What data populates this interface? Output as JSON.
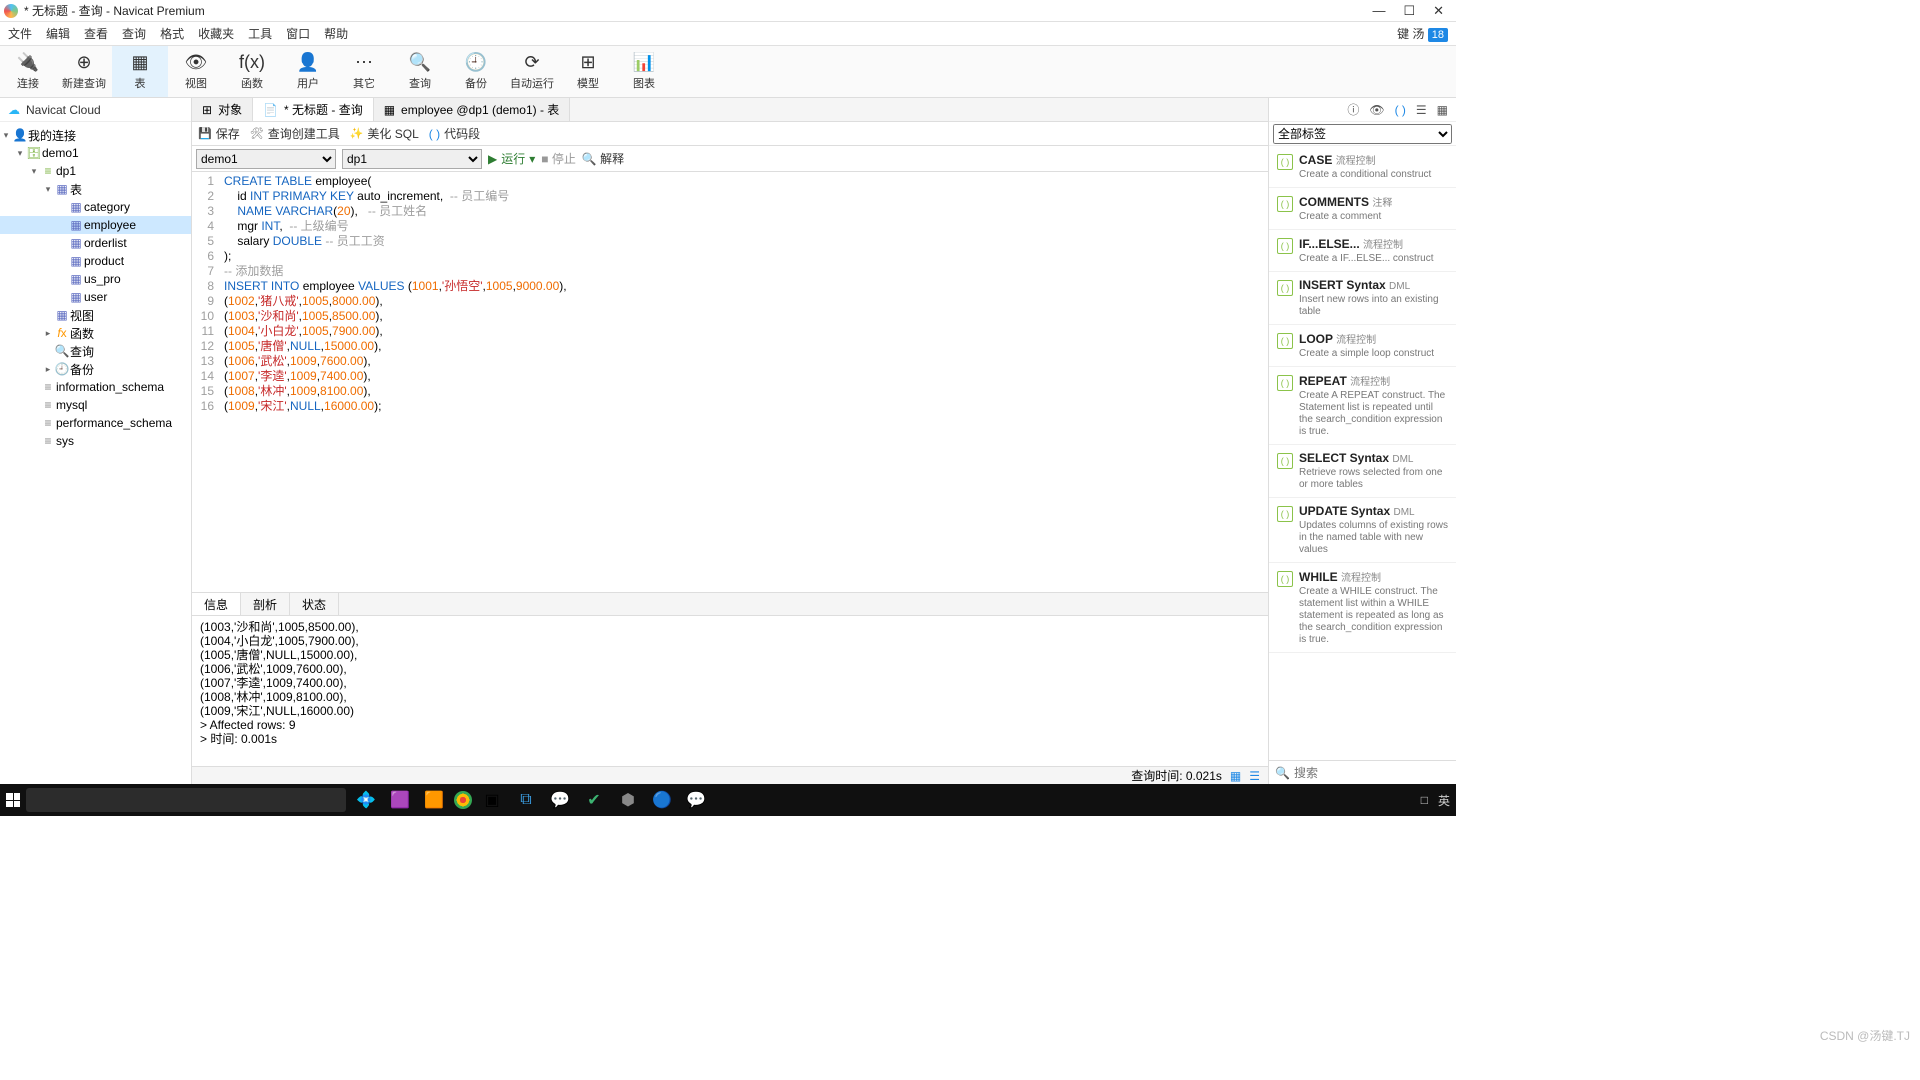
{
  "window": {
    "title": "* 无标题 - 查询 - Navicat Premium"
  },
  "menu": {
    "items": [
      "文件",
      "编辑",
      "查看",
      "查询",
      "格式",
      "收藏夹",
      "工具",
      "窗口",
      "帮助"
    ],
    "user": "键 汤",
    "badge": "18"
  },
  "toolbar": [
    {
      "icon": "🔌",
      "label": "连接"
    },
    {
      "icon": "⊕",
      "label": "新建查询"
    },
    {
      "icon": "▦",
      "label": "表",
      "active": true
    },
    {
      "icon": "👁",
      "label": "视图"
    },
    {
      "icon": "f(x)",
      "label": "函数"
    },
    {
      "icon": "👤",
      "label": "用户"
    },
    {
      "icon": "⋯",
      "label": "其它"
    },
    {
      "icon": "🔍",
      "label": "查询"
    },
    {
      "icon": "🕘",
      "label": "备份"
    },
    {
      "icon": "⟳",
      "label": "自动运行"
    },
    {
      "icon": "⊞",
      "label": "模型"
    },
    {
      "icon": "📊",
      "label": "图表"
    }
  ],
  "cloud": "Navicat Cloud",
  "tree": [
    {
      "d": 0,
      "arr": "▾",
      "ic": "👤",
      "cls": "",
      "txt": "我的连接"
    },
    {
      "d": 1,
      "arr": "▾",
      "ic": "🗄",
      "cls": "db",
      "txt": "demo1"
    },
    {
      "d": 2,
      "arr": "▾",
      "ic": "≡",
      "cls": "db",
      "txt": "dp1"
    },
    {
      "d": 3,
      "arr": "▾",
      "ic": "▦",
      "cls": "tb",
      "txt": "表"
    },
    {
      "d": 4,
      "arr": "",
      "ic": "▦",
      "cls": "tb",
      "txt": "category"
    },
    {
      "d": 4,
      "arr": "",
      "ic": "▦",
      "cls": "tb",
      "txt": "employee",
      "sel": true
    },
    {
      "d": 4,
      "arr": "",
      "ic": "▦",
      "cls": "tb",
      "txt": "orderlist"
    },
    {
      "d": 4,
      "arr": "",
      "ic": "▦",
      "cls": "tb",
      "txt": "product"
    },
    {
      "d": 4,
      "arr": "",
      "ic": "▦",
      "cls": "tb",
      "txt": "us_pro"
    },
    {
      "d": 4,
      "arr": "",
      "ic": "▦",
      "cls": "tb",
      "txt": "user"
    },
    {
      "d": 3,
      "arr": "",
      "ic": "▦",
      "cls": "tb",
      "txt": "视图"
    },
    {
      "d": 3,
      "arr": "▸",
      "ic": "fx",
      "cls": "fd",
      "txt": "函数"
    },
    {
      "d": 3,
      "arr": "",
      "ic": "🔍",
      "cls": "tb",
      "txt": "查询"
    },
    {
      "d": 3,
      "arr": "▸",
      "ic": "🕘",
      "cls": "tb",
      "txt": "备份"
    },
    {
      "d": 2,
      "arr": "",
      "ic": "≡",
      "cls": "gy",
      "txt": "information_schema"
    },
    {
      "d": 2,
      "arr": "",
      "ic": "≡",
      "cls": "gy",
      "txt": "mysql"
    },
    {
      "d": 2,
      "arr": "",
      "ic": "≡",
      "cls": "gy",
      "txt": "performance_schema"
    },
    {
      "d": 2,
      "arr": "",
      "ic": "≡",
      "cls": "gy",
      "txt": "sys"
    }
  ],
  "tabs": [
    {
      "icon": "⊞",
      "label": "对象"
    },
    {
      "icon": "📄",
      "label": "* 无标题 - 查询",
      "active": true
    },
    {
      "icon": "▦",
      "label": "employee @dp1 (demo1) - 表"
    }
  ],
  "querybar": {
    "save": "保存",
    "tools": "查询创建工具",
    "beautify": "美化 SQL",
    "snippet": "代码段"
  },
  "selrow": {
    "conn": "demo1",
    "db": "dp1",
    "run": "运行",
    "stop": "停止",
    "explain": "解释"
  },
  "code": [
    [
      [
        "kw",
        "CREATE TABLE"
      ],
      [
        "",
        " employee("
      ]
    ],
    [
      [
        "",
        "    id "
      ],
      [
        "ty",
        "INT PRIMARY KEY"
      ],
      [
        "",
        " auto_increment,  "
      ],
      [
        "cm",
        "-- 员工编号"
      ]
    ],
    [
      [
        "",
        "    "
      ],
      [
        "ty",
        "NAME VARCHAR"
      ],
      [
        "",
        "("
      ],
      [
        "num",
        "20"
      ],
      [
        "",
        "),   "
      ],
      [
        "cm",
        "-- 员工姓名"
      ]
    ],
    [
      [
        "",
        "    mgr "
      ],
      [
        "ty",
        "INT"
      ],
      [
        "",
        ",  "
      ],
      [
        "cm",
        "-- 上级编号"
      ]
    ],
    [
      [
        "",
        "    salary "
      ],
      [
        "ty",
        "DOUBLE"
      ],
      [
        "",
        " "
      ],
      [
        "cm",
        "-- 员工工资"
      ]
    ],
    [
      [
        "",
        ");"
      ]
    ],
    [
      [
        "cm",
        "-- 添加数据"
      ]
    ],
    [
      [
        "kw",
        "INSERT INTO"
      ],
      [
        "",
        " employee "
      ],
      [
        "kw",
        "VALUES"
      ],
      [
        "",
        " ("
      ],
      [
        "num",
        "1001"
      ],
      [
        "",
        ","
      ],
      [
        "str",
        "'孙悟空'"
      ],
      [
        "",
        ","
      ],
      [
        "num",
        "1005"
      ],
      [
        "",
        ","
      ],
      [
        "num",
        "9000.00"
      ],
      [
        "",
        "),"
      ]
    ],
    [
      [
        "",
        "("
      ],
      [
        "num",
        "1002"
      ],
      [
        "",
        ","
      ],
      [
        "str",
        "'猪八戒'"
      ],
      [
        "",
        ","
      ],
      [
        "num",
        "1005"
      ],
      [
        "",
        ","
      ],
      [
        "num",
        "8000.00"
      ],
      [
        "",
        "),"
      ]
    ],
    [
      [
        "",
        "("
      ],
      [
        "num",
        "1003"
      ],
      [
        "",
        ","
      ],
      [
        "str",
        "'沙和尚'"
      ],
      [
        "",
        ","
      ],
      [
        "num",
        "1005"
      ],
      [
        "",
        ","
      ],
      [
        "num",
        "8500.00"
      ],
      [
        "",
        "),"
      ]
    ],
    [
      [
        "",
        "("
      ],
      [
        "num",
        "1004"
      ],
      [
        "",
        ","
      ],
      [
        "str",
        "'小白龙'"
      ],
      [
        "",
        ","
      ],
      [
        "num",
        "1005"
      ],
      [
        "",
        ","
      ],
      [
        "num",
        "7900.00"
      ],
      [
        "",
        "),"
      ]
    ],
    [
      [
        "",
        "("
      ],
      [
        "num",
        "1005"
      ],
      [
        "",
        ","
      ],
      [
        "str",
        "'唐僧'"
      ],
      [
        "",
        ","
      ],
      [
        "kw",
        "NULL"
      ],
      [
        "",
        ","
      ],
      [
        "num",
        "15000.00"
      ],
      [
        "",
        "),"
      ]
    ],
    [
      [
        "",
        "("
      ],
      [
        "num",
        "1006"
      ],
      [
        "",
        ","
      ],
      [
        "str",
        "'武松'"
      ],
      [
        "",
        ","
      ],
      [
        "num",
        "1009"
      ],
      [
        "",
        ","
      ],
      [
        "num",
        "7600.00"
      ],
      [
        "",
        "),"
      ]
    ],
    [
      [
        "",
        "("
      ],
      [
        "num",
        "1007"
      ],
      [
        "",
        ","
      ],
      [
        "str",
        "'李逵'"
      ],
      [
        "",
        ","
      ],
      [
        "num",
        "1009"
      ],
      [
        "",
        ","
      ],
      [
        "num",
        "7400.00"
      ],
      [
        "",
        "),"
      ]
    ],
    [
      [
        "",
        "("
      ],
      [
        "num",
        "1008"
      ],
      [
        "",
        ","
      ],
      [
        "str",
        "'林冲'"
      ],
      [
        "",
        ","
      ],
      [
        "num",
        "1009"
      ],
      [
        "",
        ","
      ],
      [
        "num",
        "8100.00"
      ],
      [
        "",
        "),"
      ]
    ],
    [
      [
        "",
        "("
      ],
      [
        "num",
        "1009"
      ],
      [
        "",
        ","
      ],
      [
        "str",
        "'宋江'"
      ],
      [
        "",
        ","
      ],
      [
        "kw",
        "NULL"
      ],
      [
        "",
        ","
      ],
      [
        "num",
        "16000.00"
      ],
      [
        "",
        "); "
      ]
    ]
  ],
  "btabs": [
    "信息",
    "剖析",
    "状态"
  ],
  "output": [
    "(1003,'沙和尚',1005,8500.00),",
    "(1004,'小白龙',1005,7900.00),",
    "(1005,'唐僧',NULL,15000.00),",
    "(1006,'武松',1009,7600.00),",
    "(1007,'李逵',1009,7400.00),",
    "(1008,'林冲',1009,8100.00),",
    "(1009,'宋江',NULL,16000.00)",
    "> Affected rows: 9",
    "> 时间: 0.001s"
  ],
  "status": {
    "time": "查询时间: 0.021s"
  },
  "rpanel": {
    "filter": "全部标签",
    "snips": [
      {
        "t": "CASE",
        "c": "流程控制",
        "d": "Create a conditional construct"
      },
      {
        "t": "COMMENTS",
        "c": "注释",
        "d": "Create a comment"
      },
      {
        "t": "IF...ELSE...",
        "c": "流程控制",
        "d": "Create a IF...ELSE... construct"
      },
      {
        "t": "INSERT Syntax",
        "c": "DML",
        "d": "Insert new rows into an existing table"
      },
      {
        "t": "LOOP",
        "c": "流程控制",
        "d": "Create a simple loop construct"
      },
      {
        "t": "REPEAT",
        "c": "流程控制",
        "d": "Create A REPEAT construct. The Statement list is repeated until the search_condition expression is true."
      },
      {
        "t": "SELECT Syntax",
        "c": "DML",
        "d": "Retrieve rows selected from one or more tables"
      },
      {
        "t": "UPDATE Syntax",
        "c": "DML",
        "d": "Updates columns of existing rows in the named table with new values"
      },
      {
        "t": "WHILE",
        "c": "流程控制",
        "d": "Create a WHILE construct. The statement list within a WHILE statement is repeated as long as the search_condition expression is true."
      }
    ],
    "search": "搜索"
  },
  "watermark": "CSDN @汤键.TJ"
}
